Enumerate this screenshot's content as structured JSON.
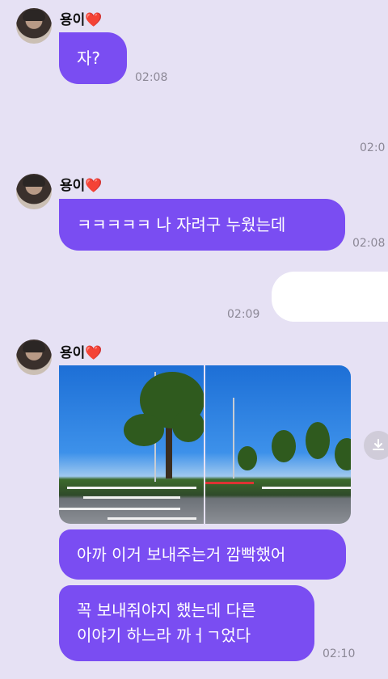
{
  "sender": {
    "name": "용이",
    "heart": "❤️"
  },
  "messages": [
    {
      "text": "자?",
      "time": "02:08"
    },
    {
      "time": "02:0"
    },
    {
      "text": "ㅋㅋㅋㅋㅋ 나 자려구 누웠는데",
      "time": "02:08"
    },
    {
      "time": "02:09"
    },
    {
      "text": "아까 이거 보내주는거 깜빡했어"
    },
    {
      "text_line1": "꼭 보내줘야지 했는데 다른",
      "text_line2": "이야기 하느라 까ㅓㄱ었다",
      "time": "02:10"
    }
  ],
  "colors": {
    "background": "#e6e1f4",
    "bubble": "#7a4df2",
    "outgoing_bubble": "#ffffff",
    "timestamp": "#8c8896"
  },
  "icons": {
    "download": "download-icon"
  }
}
